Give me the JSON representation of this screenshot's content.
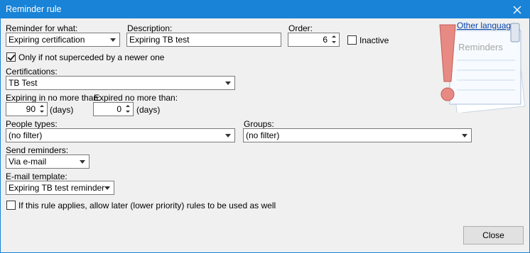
{
  "window": {
    "title": "Reminder rule",
    "accent": "#1883d7"
  },
  "reminder_for": {
    "label": "Reminder for what:",
    "value": "Expiring certification"
  },
  "description": {
    "label": "Description:",
    "value": "Expiring TB test"
  },
  "order": {
    "label": "Order:",
    "value": "6"
  },
  "inactive": {
    "label": "Inactive",
    "checked": false
  },
  "superseded": {
    "label": "Only if not superceded by a newer one",
    "checked": true
  },
  "certifications": {
    "label": "Certifications:",
    "value": "TB Test"
  },
  "expiring": {
    "label": "Expiring in no more than:",
    "value": "90",
    "unit": "(days)"
  },
  "expired": {
    "label": "Expired no more than:",
    "value": "0",
    "unit": "(days)"
  },
  "people_types": {
    "label": "People types:",
    "value": "(no filter)"
  },
  "groups": {
    "label": "Groups:",
    "value": "(no filter)"
  },
  "send_reminders": {
    "label": "Send reminders:",
    "value": "Via e-mail"
  },
  "email_template": {
    "label": "E-mail template:",
    "value": "Expiring TB test reminder"
  },
  "allow_later": {
    "label": "If this rule applies, allow later (lower priority) rules to be used as well",
    "checked": false
  },
  "other_languages": "Other languages",
  "illustration": {
    "icon": "reminders-note-icon",
    "text": "Reminders"
  },
  "close_button": "Close"
}
